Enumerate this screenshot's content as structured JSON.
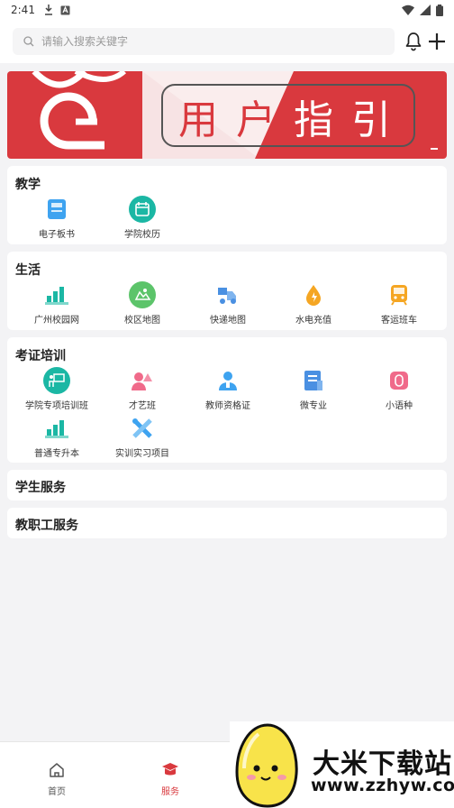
{
  "status_bar": {
    "time": "2:41"
  },
  "search": {
    "placeholder": "请输入搜索关键字"
  },
  "banner": {
    "chars": [
      "用",
      "户",
      "指",
      "引"
    ],
    "colors": {
      "red": "#d9393e",
      "pink_bg": "#f6dfe0"
    }
  },
  "sections": [
    {
      "title": "教学",
      "items": [
        {
          "label": "电子板书",
          "icon": "e-board-icon",
          "color": "#3ea3f0"
        },
        {
          "label": "学院校历",
          "icon": "calendar-icon",
          "color": "#1bb7a4"
        }
      ]
    },
    {
      "title": "生活",
      "items": [
        {
          "label": "广州校园网",
          "icon": "campus-network-icon",
          "color": "#1bb7a4"
        },
        {
          "label": "校区地图",
          "icon": "campus-map-icon",
          "color": "#5cc46a"
        },
        {
          "label": "快递地图",
          "icon": "delivery-map-icon",
          "color": "#4a90e2"
        },
        {
          "label": "水电充值",
          "icon": "water-power-icon",
          "color": "#f5a623"
        },
        {
          "label": "客运班车",
          "icon": "bus-icon",
          "color": "#f5a623"
        }
      ]
    },
    {
      "title": "考证培训",
      "items": [
        {
          "label": "学院专项培训班",
          "icon": "training-class-icon",
          "color": "#1bb7a4"
        },
        {
          "label": "才艺班",
          "icon": "talent-class-icon",
          "color": "#f06a8a"
        },
        {
          "label": "教师资格证",
          "icon": "teacher-cert-icon",
          "color": "#3ea3f0"
        },
        {
          "label": "微专业",
          "icon": "micro-major-icon",
          "color": "#4a90e2"
        },
        {
          "label": "小语种",
          "icon": "language-icon",
          "color": "#f06a8a"
        },
        {
          "label": "普通专升本",
          "icon": "upgrade-degree-icon",
          "color": "#1bb7a4"
        },
        {
          "label": "实训实习项目",
          "icon": "internship-icon",
          "color": "#3ea3f0"
        }
      ]
    },
    {
      "title": "学生服务",
      "items": []
    },
    {
      "title": "教职工服务",
      "items": []
    }
  ],
  "bottom_nav": [
    {
      "label": "首页",
      "icon": "home-icon",
      "active": false
    },
    {
      "label": "服务",
      "icon": "service-icon",
      "active": true
    }
  ],
  "colors": {
    "accent": "#d9393e",
    "active_nav": "#d9393e"
  },
  "watermark": {
    "title": "大米下载站",
    "url": "www.zzhyw.com"
  }
}
